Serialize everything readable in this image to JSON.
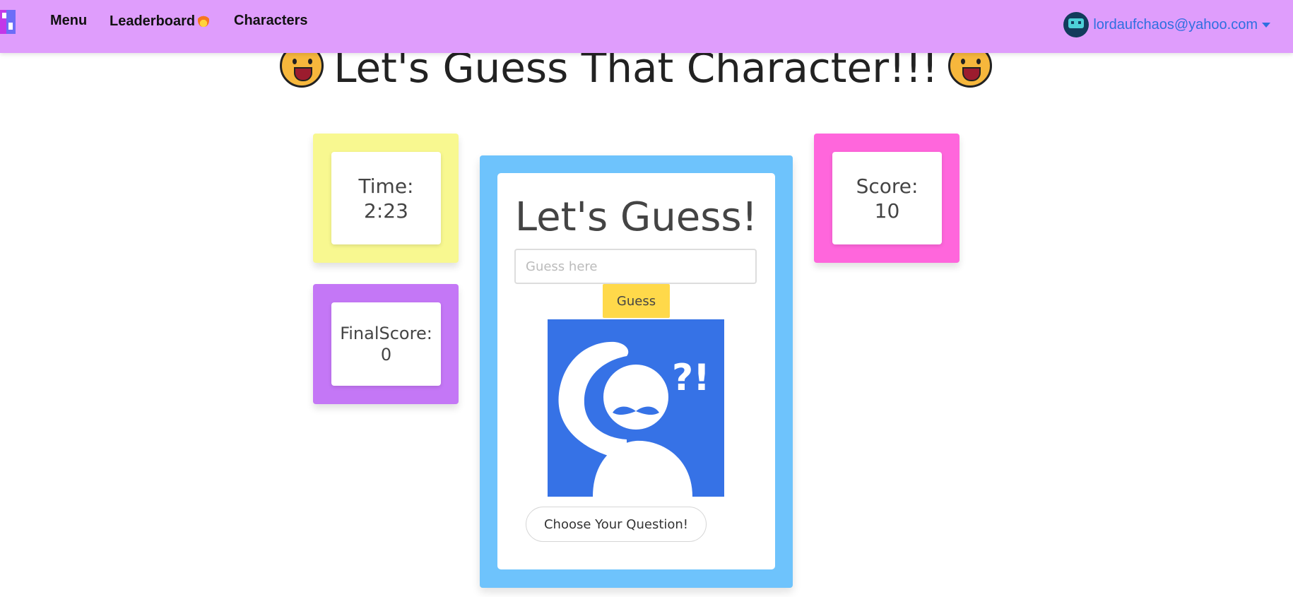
{
  "nav": {
    "menu": "Menu",
    "leaderboard": "Leaderboard",
    "characters": "Characters",
    "user_email": "lordaufchaos@yahoo.com"
  },
  "page_title": "Let's Guess That Character!!!",
  "time": {
    "label": "Time:",
    "value": "2:23"
  },
  "final_score": {
    "label": "FinalScore:",
    "value": "0"
  },
  "score": {
    "label": "Score:",
    "value": "10"
  },
  "guess_card": {
    "title": "Let's Guess!",
    "input_placeholder": "Guess here",
    "input_value": "",
    "guess_button": "Guess",
    "image_text": "?!",
    "question_button": "Choose Your Question!"
  },
  "icons": {
    "brand": "app-logo-icon",
    "leaderboard": "fire-icon",
    "title_decoration": "cat-face-icon",
    "avatar": "space-invader-avatar-icon",
    "dropdown": "caret-down-icon"
  },
  "colors": {
    "navbar": "#df9dfc",
    "time_box": "#f8f890",
    "final_score_box": "#c477f6",
    "score_box": "#ff66dc",
    "guess_panel": "#6ec3fc",
    "guess_button": "#ffd94a",
    "character_image_bg": "#3672e6",
    "user_link": "#2f6fe0"
  }
}
